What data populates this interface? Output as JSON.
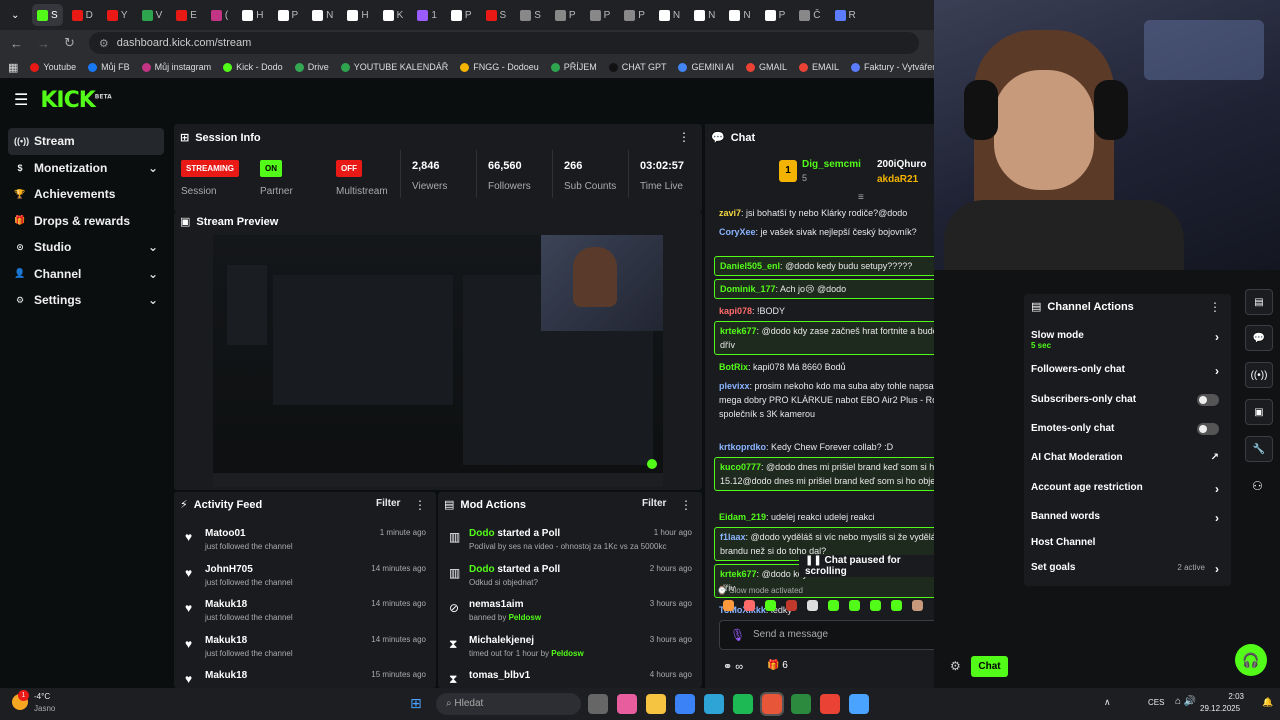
{
  "browser": {
    "url": "dashboard.kick.com/stream",
    "tab_labels": [
      "S",
      "D",
      "Y",
      "V",
      "E",
      "(",
      "H",
      "P",
      "N",
      "H",
      "K",
      "1",
      "P",
      "S",
      "S",
      "P",
      "P",
      "P",
      "N",
      "N",
      "N",
      "P",
      "Č",
      "R"
    ],
    "bookmarks": [
      "Youtube",
      "Můj FB",
      "Můj instagram",
      "Kick - Dodo",
      "Drive",
      "YOUTUBE KALENDÁŘ",
      "FNGG - Dodoeu",
      "PŘÍJEM",
      "CHAT GPT",
      "GEMINI AI",
      "GMAIL",
      "EMAIL",
      "Faktury - Vytváření",
      "PNG"
    ]
  },
  "kick": {
    "logo": "KICK",
    "beta": "BETA"
  },
  "sidebar": {
    "items": [
      {
        "label": "Stream",
        "icon": "broadcast-icon"
      },
      {
        "label": "Monetization",
        "icon": "dollar-icon"
      },
      {
        "label": "Achievements",
        "icon": "trophy-icon"
      },
      {
        "label": "Drops & rewards",
        "icon": "gift-icon"
      },
      {
        "label": "Studio",
        "icon": "studio-icon"
      },
      {
        "label": "Channel",
        "icon": "person-icon"
      },
      {
        "label": "Settings",
        "icon": "gear-icon"
      }
    ]
  },
  "session": {
    "title": "Session Info",
    "session_badge": "STREAMING",
    "session_label": "Session",
    "partner_badge": "ON",
    "partner_label": "Partner Income",
    "multistream_badge": "OFF",
    "multistream_label": "Multistream",
    "viewers": "2,846",
    "viewers_label": "Viewers",
    "followers": "66,560",
    "followers_label": "Followers",
    "subs": "266",
    "subs_label": "Sub Counts",
    "time": "03:02:57",
    "time_label": "Time Live"
  },
  "preview": {
    "title": "Stream Preview"
  },
  "activity": {
    "title": "Activity Feed",
    "filter": "Filter",
    "items": [
      {
        "name": "Matoo01",
        "text": "just followed the channel",
        "time": "1 minute ago"
      },
      {
        "name": "JohnH705",
        "text": "just followed the channel",
        "time": "14 minutes ago"
      },
      {
        "name": "Makuk18",
        "text": "just followed the channel",
        "time": "14 minutes ago"
      },
      {
        "name": "Makuk18",
        "text": "just followed the channel",
        "time": "14 minutes ago"
      },
      {
        "name": "Makuk18",
        "text": "",
        "time": "15 minutes ago"
      }
    ]
  },
  "mod": {
    "title": "Mod Actions",
    "filter": "Filter",
    "items": [
      {
        "user": "Dodo",
        "action": " started a Poll",
        "detail": "Podíval by ses na video - ohnostoj za 1Kc vs za 5000kc",
        "by": "",
        "time": "1 hour ago"
      },
      {
        "user": "Dodo",
        "action": " started a Poll",
        "detail": "Odkud si objednat?",
        "by": "",
        "time": "2 hours ago"
      },
      {
        "user": "nemas1aim",
        "action": "",
        "detail": "banned by ",
        "by": "Peldosw",
        "time": "3 hours ago"
      },
      {
        "user": "Michalekjenej",
        "action": "",
        "detail": "timed out for 1 hour by ",
        "by": "Peldosw",
        "time": "3 hours ago"
      },
      {
        "user": "tomas_blbv1",
        "action": "",
        "detail": "",
        "by": "",
        "time": "4 hours ago"
      }
    ]
  },
  "chat": {
    "title": "Chat",
    "top1": "Dig_semcmi",
    "top1_count": "5",
    "top2": "200iQhuro",
    "top3": "akdaR21",
    "rank": "1",
    "messages": [
      {
        "user": "zavi7",
        "text": " jsi bohatší ty nebo Klárky rodiče?@dodo",
        "color": "#f5d742"
      },
      {
        "user": "CoryXee",
        "text": " je vašek sivak nejlepší český bojovník?",
        "color": "#8ab4ff"
      },
      {
        "user": "Daniel505_enl",
        "text": " @dodo kedy budu setupy?????",
        "color": "#53fc18"
      },
      {
        "user": "Dominik_177",
        "text": " Ach jo😢 @dodo",
        "color": "#53fc18"
      },
      {
        "user": "kapi078",
        "text": " !BODY",
        "color": "#ff6b6b"
      },
      {
        "user": "krtek677",
        "text": " @dodo kdy zase začneš hrat fortnite a budou no-scopy jako dřív",
        "color": "#53fc18"
      },
      {
        "user": "BotRix",
        "text": " kapi078 Má 8660 Bodů",
        "color": "#53fc18"
      },
      {
        "user": "plevixx",
        "text": " prosim nekoho kdo ma suba aby tohle napsal mam... je to mega dobry PRO KLÁRKUE nabot EBO Air2 Plus - Robotický AI společník s 3K kamerou",
        "color": "#8ab4ff"
      },
      {
        "user": "krtkoprdko",
        "text": " Kedy Chew Forever collab? :D",
        "color": "#8ab4ff"
      },
      {
        "user": "kuco0777",
        "text": " @dodo dnes mi prišiel brand keď som si ho objednával 15.12@dodo dnes mi prišiel brand keď som si ho objednával 15.12",
        "color": "#53fc18"
      },
      {
        "user": "Eidam_219",
        "text": " udelej reakci udelej reakci",
        "color": "#53fc18"
      },
      {
        "user": "f1laax",
        "text": " @dodo vyděláš si víc nebo myslíš si že vyděláš víc z toho brandu než si do toho dal?",
        "color": "#8ab4ff"
      },
      {
        "user": "krtek677",
        "text": " @dodo kdy zase začneš hrat fortnite a budou no-scopy jako dřív",
        "color": "#53fc18"
      },
      {
        "user": "ToMoXikkk",
        "text": " ledky",
        "color": "#8ab4ff"
      }
    ],
    "paused": "Chat paused for scrolling",
    "slow": "Slow mode activated",
    "placeholder": "Send a message",
    "gift_count": "6",
    "send": "Chat"
  },
  "channel_actions": {
    "title": "Channel Actions",
    "items": [
      {
        "label": "Slow mode",
        "sub": "5 sec"
      },
      {
        "label": "Followers-only chat"
      },
      {
        "label": "Subscribers-only chat"
      },
      {
        "label": "Emotes-only chat"
      },
      {
        "label": "AI Chat Moderation"
      },
      {
        "label": "Account age restriction"
      },
      {
        "label": "Banned words"
      },
      {
        "label": "Host Channel"
      },
      {
        "label": "Set goals",
        "extra": "2 active"
      }
    ]
  },
  "taskbar": {
    "weather_temp": "-4°C",
    "weather_text": "Jasno",
    "weather_badge": "1",
    "search": "Hledat",
    "lang": "CES",
    "time": "2:03",
    "date": "29.12.2025"
  },
  "colors": {
    "accent": "#53fc18",
    "red": "#e91916",
    "panel": "#191b1f"
  }
}
